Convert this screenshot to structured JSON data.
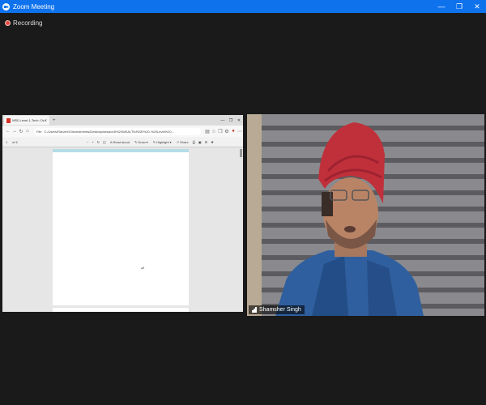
{
  "window": {
    "title": "Zoom Meeting"
  },
  "recording": {
    "label": "Recording"
  },
  "shared_screen": {
    "tab_title": "NSE-Level-1-Tech: Oct 2023...",
    "new_tab": "+",
    "address": "C:/Users/Rana%20Investments/Desktop/session5%20WEALTH/NSE%20-%20Level%20...",
    "file_label": "File",
    "page_number": "1",
    "page_of": "of 6",
    "zoom_minus": "−",
    "zoom_plus": "+",
    "read_aloud": "Read aloud",
    "draw": "Draw",
    "highlight": "Highlight",
    "share": "Share"
  },
  "participant": {
    "name": "Shamsher Singh"
  },
  "colors": {
    "titlebar": "#0e72ed",
    "recording": "#e8483f"
  }
}
